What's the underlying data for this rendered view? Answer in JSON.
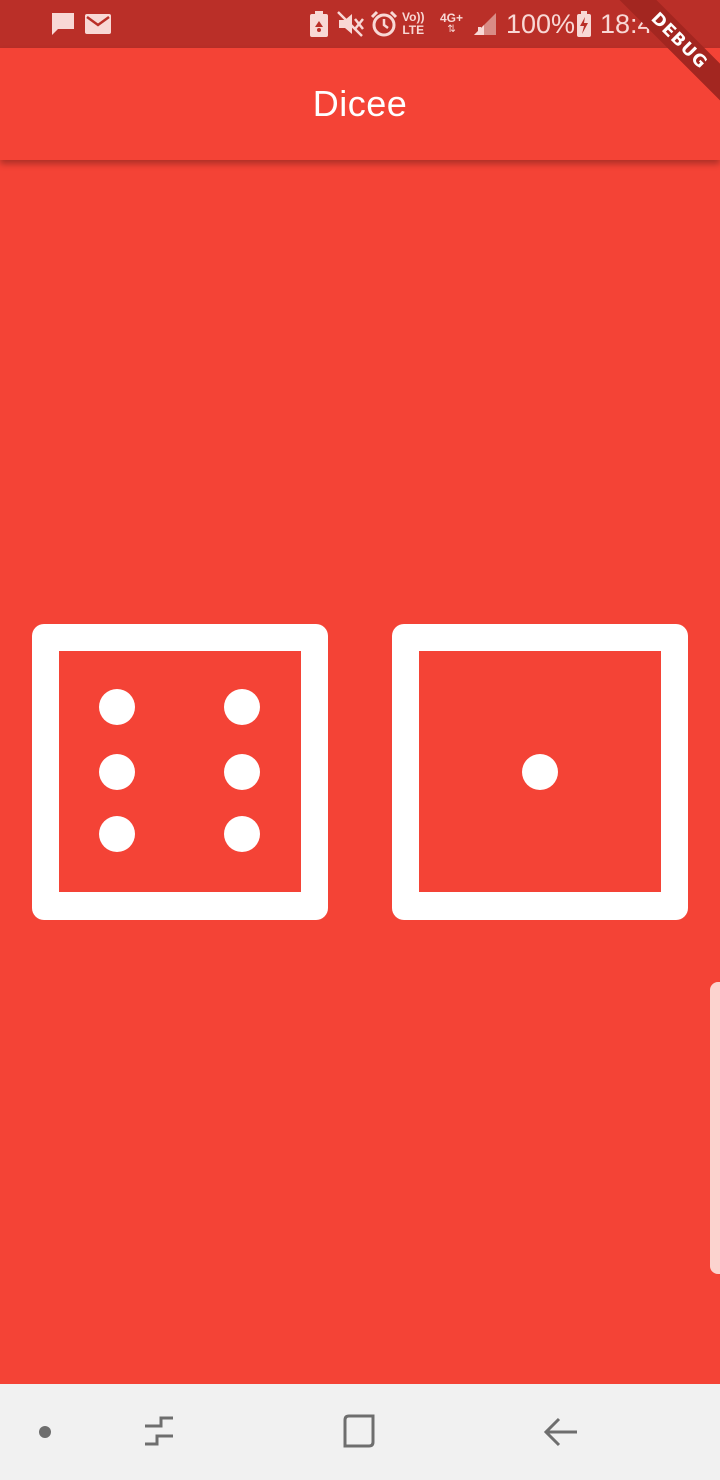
{
  "status_bar": {
    "battery": "100%",
    "time": "18:48",
    "volte_label_top": "Vo))",
    "volte_label_bottom": "LTE",
    "network": "4G+"
  },
  "app_bar": {
    "title": "Dicee"
  },
  "debug_banner": "DEBUG",
  "dice": [
    {
      "name": "left-die",
      "value": 6
    },
    {
      "name": "right-die",
      "value": 1
    }
  ],
  "colors": {
    "background": "#F44336",
    "status_bar": "#BA2F28",
    "die": "#FFFFFF",
    "nav_bar": "#F1F1F1",
    "nav_icon": "#6E6E6E"
  },
  "icons": {
    "status_left": [
      "message-icon",
      "mail-icon"
    ],
    "status_right": [
      "battery-saver-icon",
      "mute-icon",
      "alarm-icon",
      "volte-icon",
      "network-icon",
      "signal-icon",
      "charging-battery-icon"
    ],
    "nav": [
      "dot-icon",
      "recent-apps-icon",
      "home-icon",
      "back-icon"
    ]
  }
}
